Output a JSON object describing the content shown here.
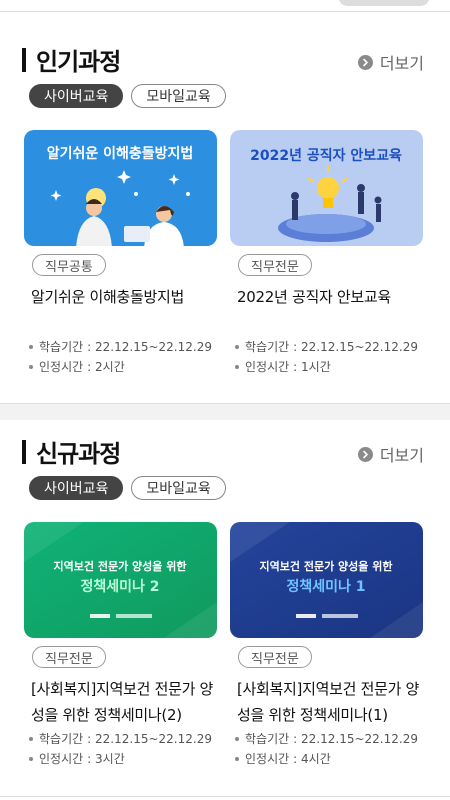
{
  "popular": {
    "title": "인기과정",
    "more_label": "더보기",
    "tabs": [
      {
        "label": "사이버교육",
        "active": true
      },
      {
        "label": "모바일교육",
        "active": false
      }
    ],
    "cards": [
      {
        "thumb_text": "알기쉬운 이해충돌방지법",
        "category": "직무공통",
        "title": "알기쉬운 이해충돌방지법",
        "period_label": "학습기간",
        "period": "22.12.15~22.12.29",
        "hours_label": "인정시간",
        "hours": "2시간"
      },
      {
        "thumb_text": "2022년 공직자 안보교육",
        "category": "직무전문",
        "title": "2022년 공직자 안보교육",
        "period_label": "학습기간",
        "period": "22.12.15~22.12.29",
        "hours_label": "인정시간",
        "hours": "1시간"
      }
    ]
  },
  "new_courses": {
    "title": "신규과정",
    "more_label": "더보기",
    "tabs": [
      {
        "label": "사이버교육",
        "active": true
      },
      {
        "label": "모바일교육",
        "active": false
      }
    ],
    "cards": [
      {
        "thumb_line1": "지역보건 전문가 양성을 위한",
        "thumb_line2": "정책세미나 2",
        "category": "직무전문",
        "title": "[사회복지]지역보건 전문가 양성을 위한 정책세미나(2)",
        "period_label": "학습기간",
        "period": "22.12.15~22.12.29",
        "hours_label": "인정시간",
        "hours": "3시간"
      },
      {
        "thumb_line1": "지역보건 전문가 양성을 위한",
        "thumb_line2": "정책세미나 1",
        "category": "직무전문",
        "title": "[사회복지]지역보건 전문가 양성을 위한 정책세미나(1)",
        "period_label": "학습기간",
        "period": "22.12.15~22.12.29",
        "hours_label": "인정시간",
        "hours": "4시간"
      }
    ]
  },
  "colors": {
    "thumb_blue": "#2d8fe0",
    "thumb_lightblue": "#b9cdf2",
    "thumb_green": "#17a86b",
    "thumb_navy": "#1f3d8f",
    "title_accent": "#1c4fbf"
  }
}
